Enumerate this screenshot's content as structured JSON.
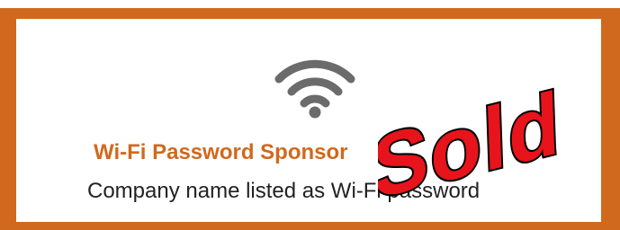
{
  "card": {
    "title": "Wi-Fi Password Sponsor",
    "subtitle": "Company name listed as Wi-Fi password",
    "wifi_icon": "wifi-icon",
    "border_color": "#d0691e",
    "title_color": "#d0691e"
  },
  "stamp": {
    "text": "Sold",
    "fill_color": "#e8141b",
    "outline_color": "#000000"
  }
}
